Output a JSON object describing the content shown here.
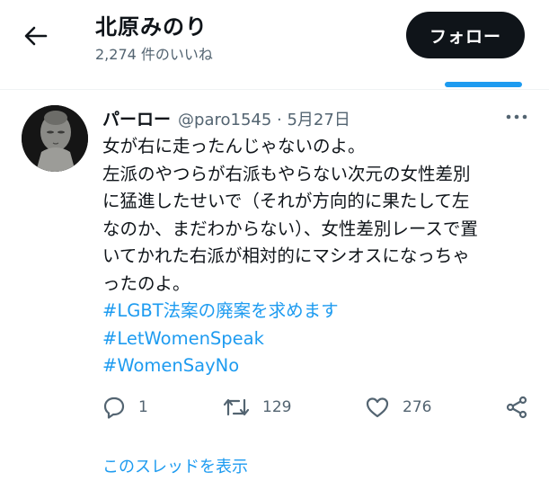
{
  "header": {
    "title": "北原みのり",
    "subtitle": "2,274 件のいいね",
    "follow_label": "フォロー"
  },
  "tweet": {
    "author_name": "パーロー",
    "meta": "@paro1545 · 5月27日",
    "lines": [
      "女が右に走ったんじゃないのよ。",
      "左派のやつらが右派もやらない次元の女性差別",
      "に猛進したせいで（それが方向的に果たして左",
      "なのか、まだわからない）、女性差別レースで置",
      "いてかれた右派が相対的にマシオスになっちゃ",
      "ったのよ。"
    ],
    "hashtags": [
      "#LGBT法案の廃案を求めます",
      "#LetWomenSpeak",
      "#WomenSayNo"
    ],
    "replies": "1",
    "retweets": "129",
    "likes": "276",
    "thread_link": "このスレッドを表示"
  },
  "icons": {
    "back": "back-arrow-icon",
    "more": "more-dots-icon",
    "reply": "reply-icon",
    "retweet": "retweet-icon",
    "like": "heart-icon",
    "share": "share-icon"
  },
  "colors": {
    "accent": "#1d9bf0",
    "text": "#0f1419",
    "muted": "#536471",
    "button": "#0f1419"
  }
}
